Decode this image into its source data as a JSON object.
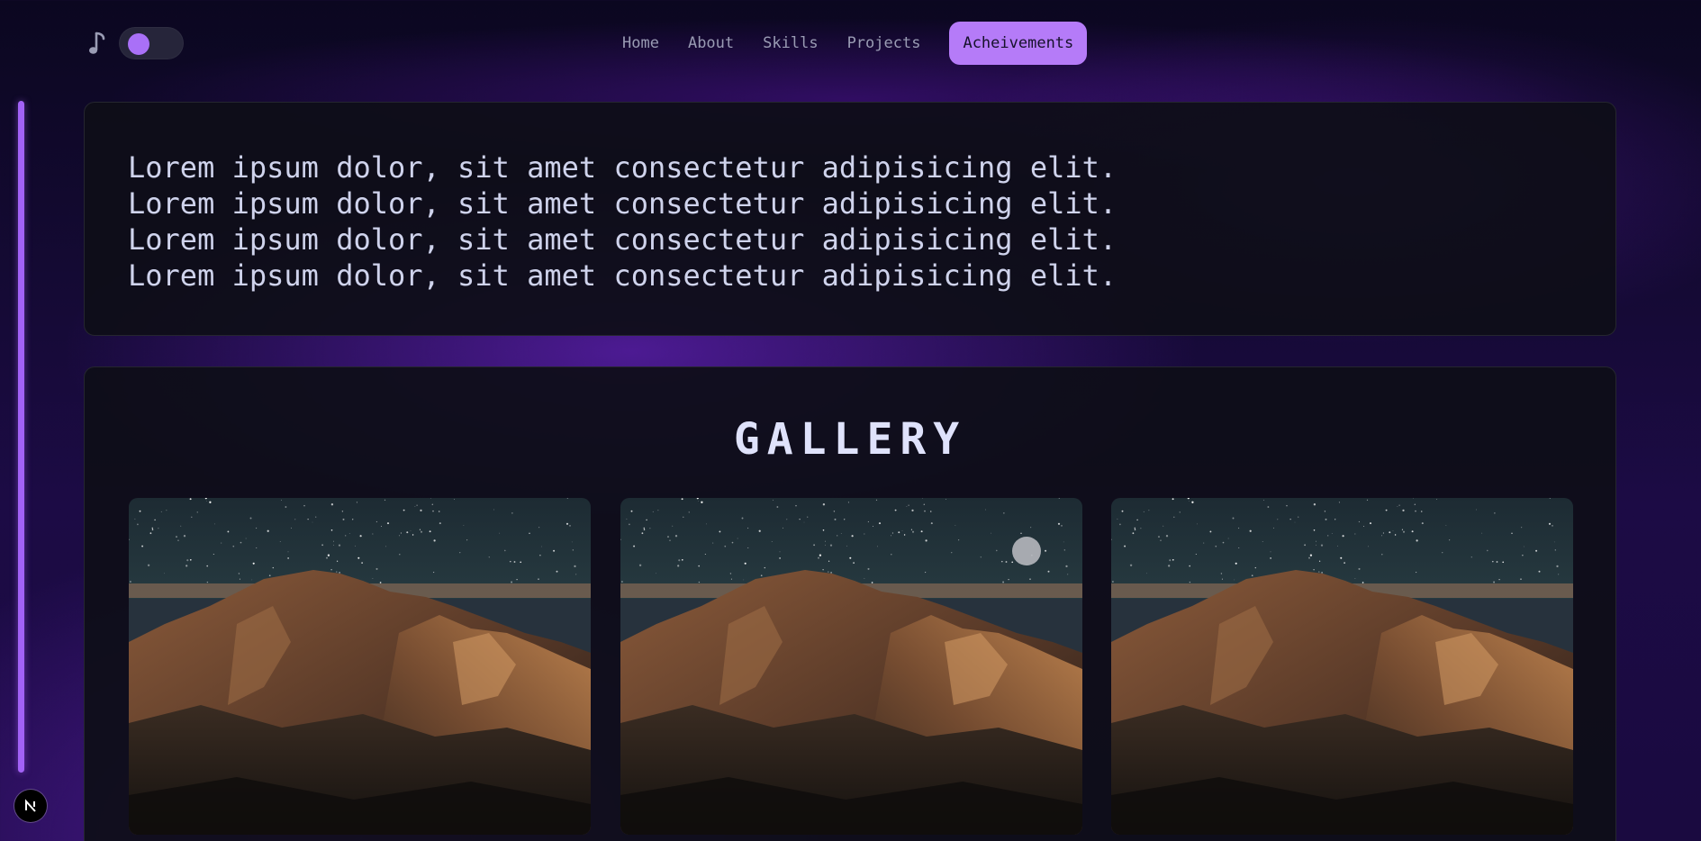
{
  "header": {
    "music_icon": "music-note-icon",
    "theme_toggle": {
      "state": "on",
      "accent": "#a970f7"
    },
    "nav": [
      {
        "label": "Home",
        "active": false
      },
      {
        "label": "About",
        "active": false
      },
      {
        "label": "Skills",
        "active": false
      },
      {
        "label": "Projects",
        "active": false
      },
      {
        "label": "Acheivements",
        "active": true
      }
    ]
  },
  "intro": {
    "lines": [
      "Lorem ipsum dolor, sit amet consectetur adipisicing elit.",
      "Lorem ipsum dolor, sit amet consectetur adipisicing elit.",
      "Lorem ipsum dolor, sit amet consectetur adipisicing elit.",
      "Lorem ipsum dolor, sit amet consectetur adipisicing elit."
    ]
  },
  "gallery": {
    "title": "GALLERY",
    "images": [
      {
        "subject": "mountain-night-landscape"
      },
      {
        "subject": "mountain-night-landscape"
      },
      {
        "subject": "mountain-night-landscape"
      }
    ]
  },
  "badge": {
    "icon": "next-logo-icon"
  },
  "colors": {
    "accent": "#b57bf8",
    "rail": "#a262f6",
    "card_bg": "#0e0e18",
    "text": "#cfd3ec"
  }
}
